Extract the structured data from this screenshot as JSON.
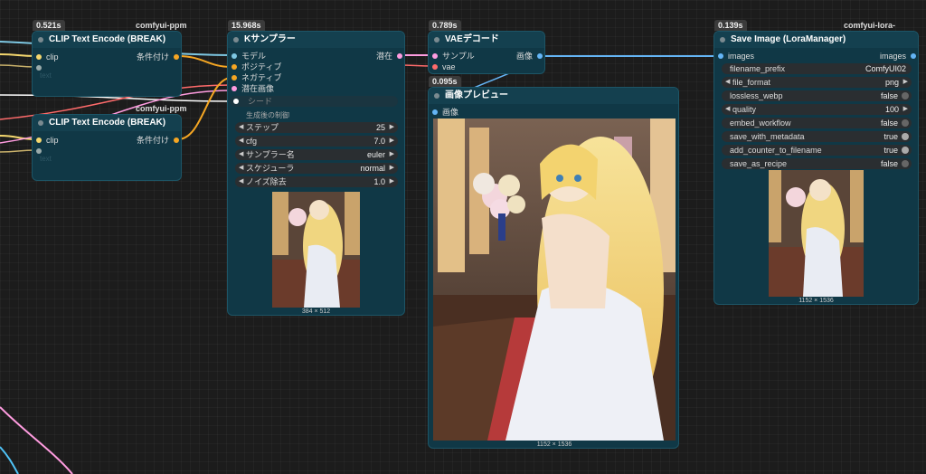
{
  "nodes": {
    "clip1": {
      "timing": "0.521s",
      "source": "comfyui-ppm",
      "title": "CLIP Text Encode (BREAK)",
      "in_clip": "clip",
      "out_cond": "条件付け",
      "text_label": "text"
    },
    "clip2": {
      "source": "comfyui-ppm",
      "title": "CLIP Text Encode (BREAK)",
      "in_clip": "clip",
      "out_cond": "条件付け",
      "text_label": "text"
    },
    "ksampler": {
      "timing": "15.968s",
      "title": "Kサンプラー",
      "inputs": [
        "モデル",
        "ポジティブ",
        "ネガティブ",
        "潜在画像"
      ],
      "out_latent": "潜在",
      "seed_label": "シード",
      "section_label": "生成後の制御",
      "widgets": [
        {
          "label": "ステップ",
          "value": "25"
        },
        {
          "label": "cfg",
          "value": "7.0"
        },
        {
          "label": "サンプラー名",
          "value": "euler"
        },
        {
          "label": "スケジューラ",
          "value": "normal"
        },
        {
          "label": "ノイズ除去",
          "value": "1.0"
        }
      ],
      "preview_caption": "384 × 512"
    },
    "vae": {
      "timing": "0.789s",
      "title": "VAEデコード",
      "in_samples": "サンプル",
      "in_vae": "vae",
      "out_image": "画像"
    },
    "preview": {
      "timing": "0.095s",
      "title": "画像プレビュー",
      "in_image": "画像",
      "caption": "1152 × 1536"
    },
    "save": {
      "timing": "0.139s",
      "source": "comfyui-lora-manager",
      "title": "Save Image (LoraManager)",
      "in_images": "images",
      "out_images": "images",
      "widgets": [
        {
          "label": "filename_prefix",
          "value": "ComfyUI02"
        },
        {
          "label": "file_format",
          "value": "png"
        },
        {
          "label": "lossless_webp",
          "value": "false"
        },
        {
          "label": "quality",
          "value": "100"
        },
        {
          "label": "embed_workflow",
          "value": "false"
        },
        {
          "label": "save_with_metadata",
          "value": "true"
        },
        {
          "label": "add_counter_to_filename",
          "value": "true"
        },
        {
          "label": "save_as_recipe",
          "value": "false"
        }
      ],
      "caption": "1152 × 1536"
    }
  },
  "colors": {
    "node_bg": "#103846",
    "wire_clip": "#f5d76e",
    "wire_cond": "#f5a623",
    "wire_model": "#7ec8e3",
    "wire_latent": "#ff9ce0",
    "wire_vae": "#ff6b6b",
    "wire_image": "#64b5f6"
  }
}
